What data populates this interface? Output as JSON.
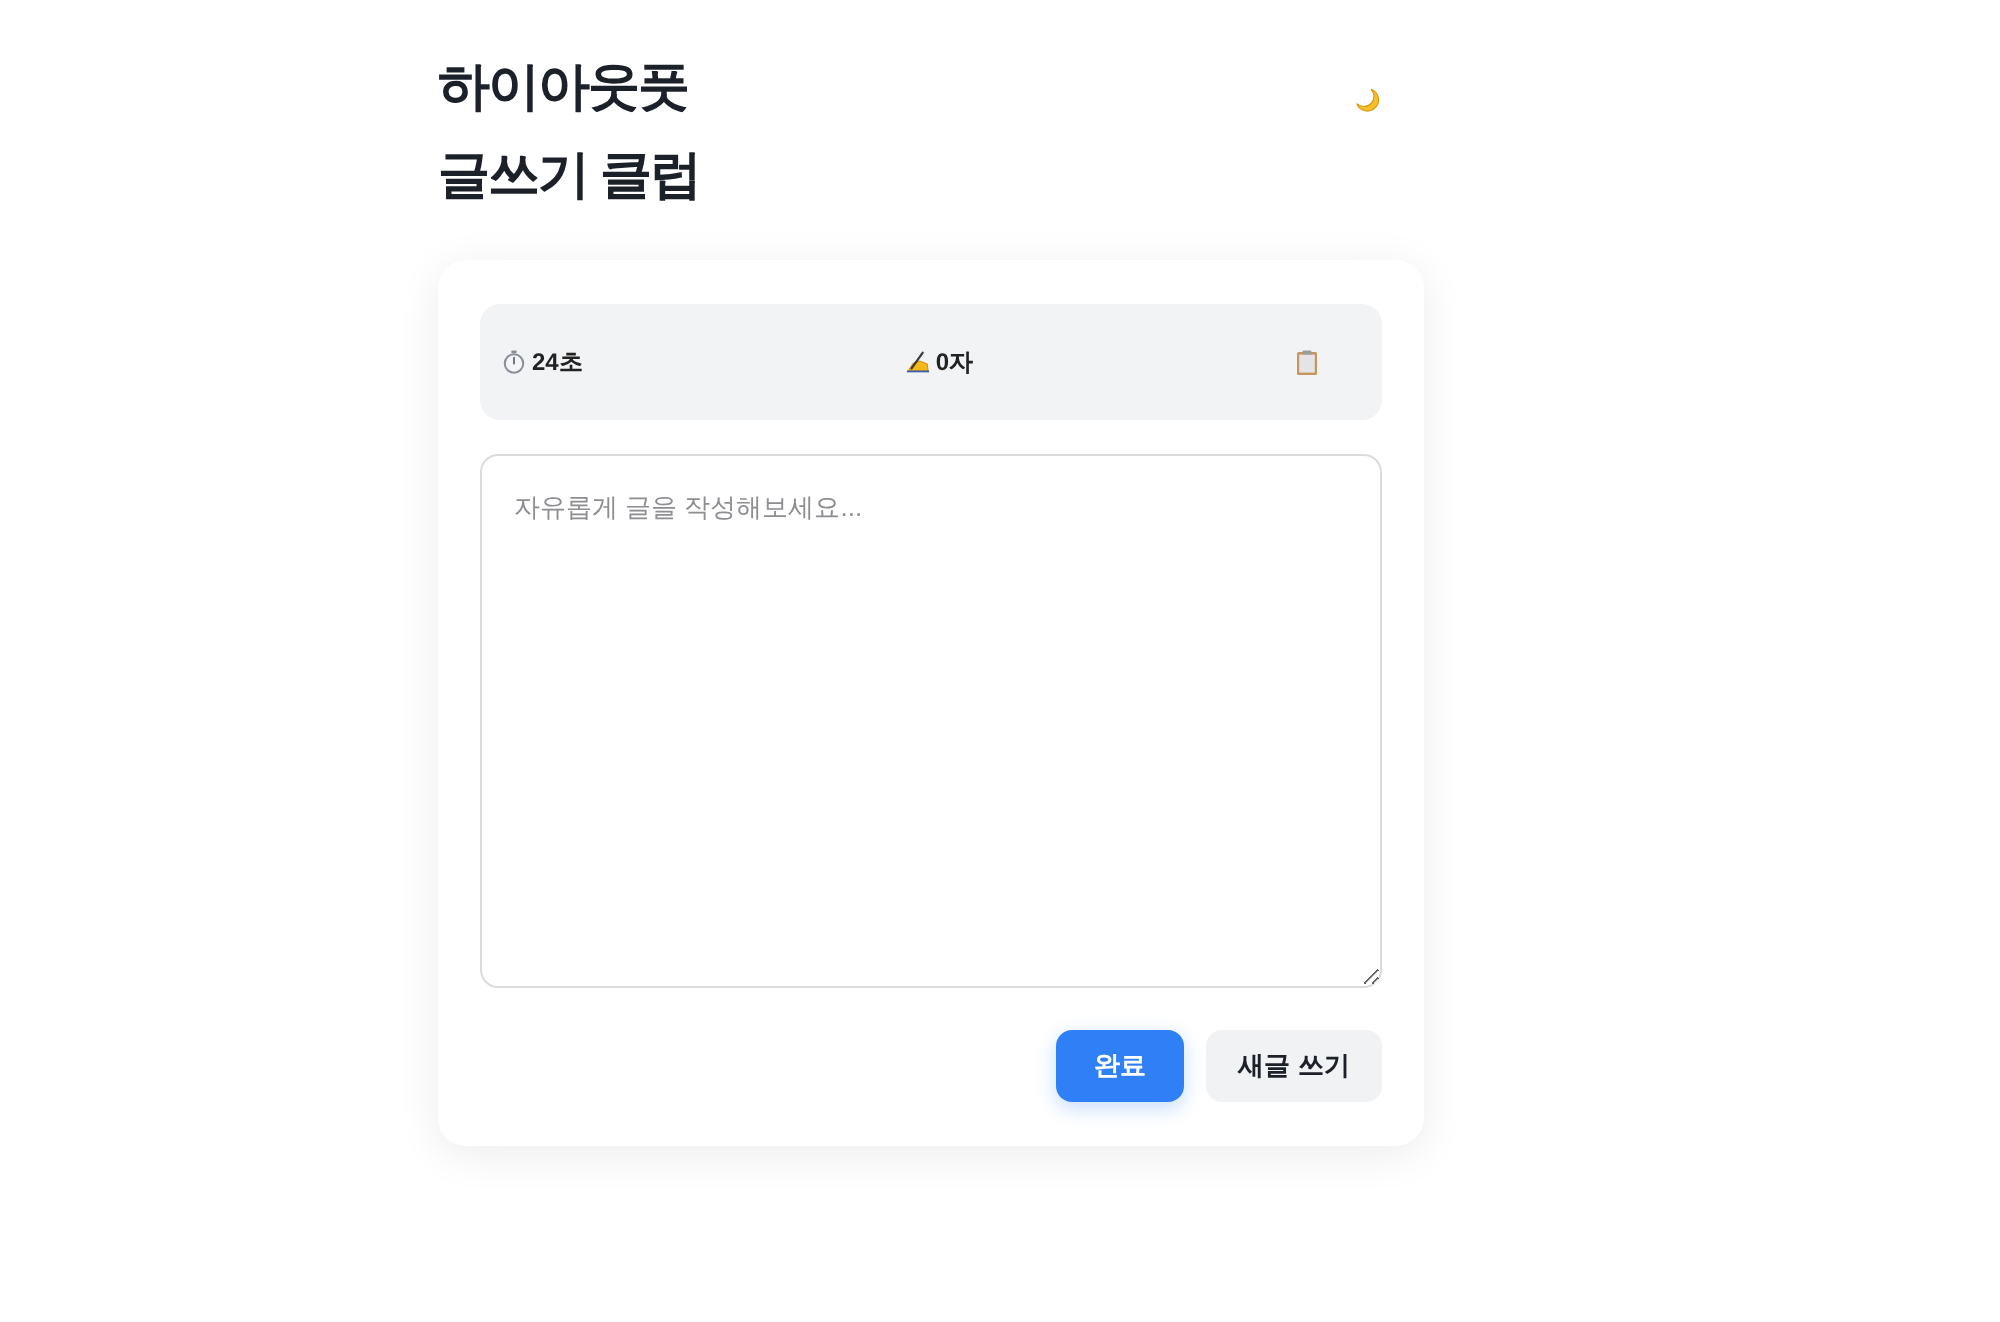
{
  "header": {
    "title_lines": [
      "하이아웃풋",
      "글쓰기 클럽"
    ]
  },
  "stats": [
    {
      "kind": "timer",
      "text": "24초"
    },
    {
      "kind": "chars",
      "text": "0자"
    },
    {
      "kind": "clipboard"
    }
  ],
  "editor": {
    "placeholder": "자유롭게 글을 작성해보세요..."
  },
  "buttons": [
    {
      "kind": "primary",
      "label": "완료"
    },
    {
      "kind": "secondary",
      "label": "새글 쓰기"
    }
  ]
}
